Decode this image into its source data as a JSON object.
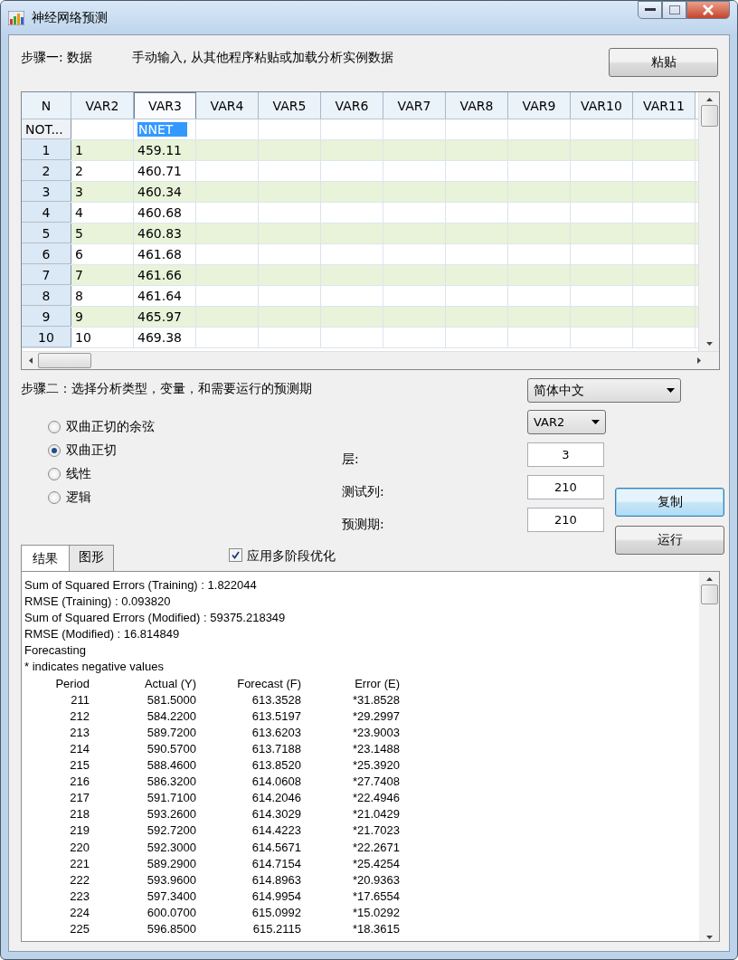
{
  "window": {
    "title": "神经网络预测"
  },
  "step1": {
    "label": "步骤一: 数据",
    "hint": "手动输入, 从其他程序粘贴或加载分析实例数据",
    "paste_button": "粘贴"
  },
  "grid": {
    "columns": [
      {
        "label": "N",
        "selected": false
      },
      {
        "label": "VAR2",
        "selected": false
      },
      {
        "label": "VAR3",
        "selected": true
      },
      {
        "label": "VAR4",
        "selected": false
      },
      {
        "label": "VAR5",
        "selected": false
      },
      {
        "label": "VAR6",
        "selected": false
      },
      {
        "label": "VAR7",
        "selected": false
      },
      {
        "label": "VAR8",
        "selected": false
      },
      {
        "label": "VAR9",
        "selected": false
      },
      {
        "label": "VAR10",
        "selected": false
      },
      {
        "label": "VAR11",
        "selected": false
      }
    ],
    "names_row": {
      "label": "NOT...",
      "cells": [
        {
          "selected": false
        },
        {
          "text": "NNET",
          "selected": true
        }
      ]
    },
    "rows": [
      {
        "n": "1",
        "cells": [
          "1",
          "459.11"
        ]
      },
      {
        "n": "2",
        "cells": [
          "2",
          "460.71"
        ]
      },
      {
        "n": "3",
        "cells": [
          "3",
          "460.34"
        ]
      },
      {
        "n": "4",
        "cells": [
          "4",
          "460.68"
        ]
      },
      {
        "n": "5",
        "cells": [
          "5",
          "460.83"
        ]
      },
      {
        "n": "6",
        "cells": [
          "6",
          "461.68"
        ]
      },
      {
        "n": "7",
        "cells": [
          "7",
          "461.66"
        ]
      },
      {
        "n": "8",
        "cells": [
          "8",
          "461.64"
        ]
      },
      {
        "n": "9",
        "cells": [
          "9",
          "465.97"
        ]
      },
      {
        "n": "10",
        "cells": [
          "10",
          "469.38"
        ]
      }
    ]
  },
  "step2": {
    "label": "步骤二：选择分析类型，变量，和需要运行的预测期",
    "language": "简体中文",
    "variable": "VAR2",
    "functions": [
      {
        "label": "双曲正切的余弦",
        "selected": false
      },
      {
        "label": "双曲正切",
        "selected": true
      },
      {
        "label": "线性",
        "selected": false
      },
      {
        "label": "逻辑",
        "selected": false
      }
    ],
    "fields": [
      {
        "label": "层:",
        "value": "3"
      },
      {
        "label": "测试列:",
        "value": "210"
      },
      {
        "label": "预测期:",
        "value": "210"
      }
    ],
    "copy_button": {
      "label": "复制",
      "focused": true
    },
    "run_button": {
      "label": "运行",
      "focused": false
    },
    "multistage": {
      "label": "应用多阶段优化",
      "checked": true
    }
  },
  "tabs": [
    {
      "label": "结果",
      "selected": true
    },
    {
      "label": "图形",
      "selected": false
    }
  ],
  "output": {
    "lines": [
      "Sum of Squared Errors (Training) : 1.822044",
      "RMSE (Training) : 0.093820",
      "Sum of Squared Errors (Modified) : 59375.218349",
      "RMSE (Modified) : 16.814849",
      "Forecasting",
      "* indicates negative values"
    ],
    "columns": [
      "Period",
      "Actual (Y)",
      "Forecast (F)",
      "Error (E)"
    ],
    "rows": [
      [
        "211",
        "581.5000",
        "613.3528",
        "*31.8528"
      ],
      [
        "212",
        "584.2200",
        "613.5197",
        "*29.2997"
      ],
      [
        "213",
        "589.7200",
        "613.6203",
        "*23.9003"
      ],
      [
        "214",
        "590.5700",
        "613.7188",
        "*23.1488"
      ],
      [
        "215",
        "588.4600",
        "613.8520",
        "*25.3920"
      ],
      [
        "216",
        "586.3200",
        "614.0608",
        "*27.7408"
      ],
      [
        "217",
        "591.7100",
        "614.2046",
        "*22.4946"
      ],
      [
        "218",
        "593.2600",
        "614.3029",
        "*21.0429"
      ],
      [
        "219",
        "592.7200",
        "614.4223",
        "*21.7023"
      ],
      [
        "220",
        "592.3000",
        "614.5671",
        "*22.2671"
      ],
      [
        "221",
        "589.2900",
        "614.7154",
        "*25.4254"
      ],
      [
        "222",
        "593.9600",
        "614.8963",
        "*20.9363"
      ],
      [
        "223",
        "597.3400",
        "614.9954",
        "*17.6554"
      ],
      [
        "224",
        "600.0700",
        "615.0992",
        "*15.0292"
      ],
      [
        "225",
        "596.8500",
        "615.2115",
        "*18.3615"
      ]
    ]
  }
}
